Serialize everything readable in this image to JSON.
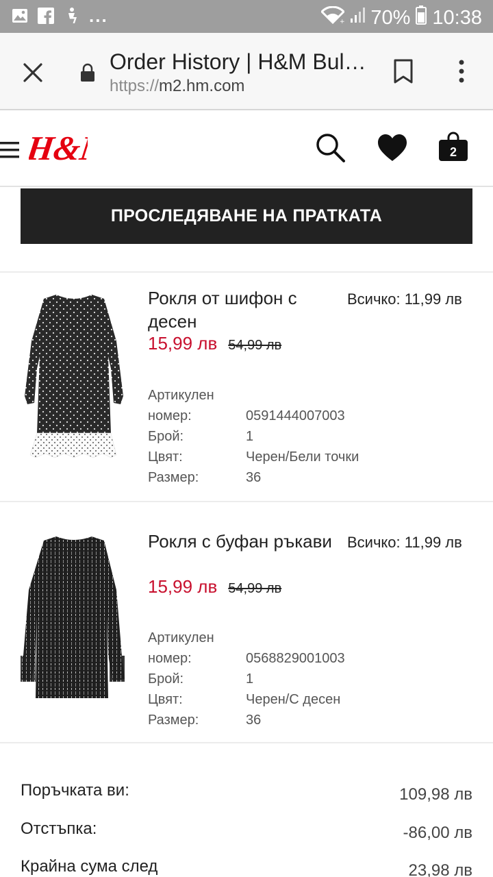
{
  "status_bar": {
    "battery": "70%",
    "time": "10:38",
    "icons": [
      "image-icon",
      "facebook-icon",
      "accessibility-icon",
      "more-icon",
      "wifi-icon",
      "signal-icon",
      "battery-icon"
    ]
  },
  "browser": {
    "title": "Order History | H&M Bul…",
    "url_scheme": "https://",
    "url_host": "m2.hm.com"
  },
  "header": {
    "logo_text": "H&M",
    "bag_count": "2",
    "brand_color": "#e50010"
  },
  "track_button": {
    "label": "ПРОСЛЕДЯВАНЕ НА ПРАТКАТА"
  },
  "items": [
    {
      "name": "Рокля от шифон с десен",
      "total": "Всичко: 11,99 лв",
      "sale_price": "15,99 лв",
      "original_price": "54,99 лв",
      "specs": [
        {
          "label": "Артикулен",
          "value": ""
        },
        {
          "label": "номер:",
          "value": "0591444007003"
        },
        {
          "label": "Брой:",
          "value": "1"
        },
        {
          "label": "Цвят:",
          "value": "Черен/Бели точки"
        },
        {
          "label": "Размер:",
          "value": "36"
        }
      ]
    },
    {
      "name": "Рокля с буфан ръкави",
      "total": "Всичко: 11,99 лв",
      "sale_price": "15,99 лв",
      "original_price": "54,99 лв",
      "specs": [
        {
          "label": "Артикулен",
          "value": ""
        },
        {
          "label": "номер:",
          "value": "0568829001003"
        },
        {
          "label": "Брой:",
          "value": "1"
        },
        {
          "label": "Цвят:",
          "value": "Черен/С десен"
        },
        {
          "label": "Размер:",
          "value": "36"
        }
      ]
    }
  ],
  "summary": {
    "order_label": "Поръчката ви:",
    "order_value": "109,98 лв",
    "discount_label": "Отстъпка:",
    "discount_value": "-86,00 лв",
    "final_label": "Крайна сума след",
    "final_value": "23,98 лв"
  }
}
